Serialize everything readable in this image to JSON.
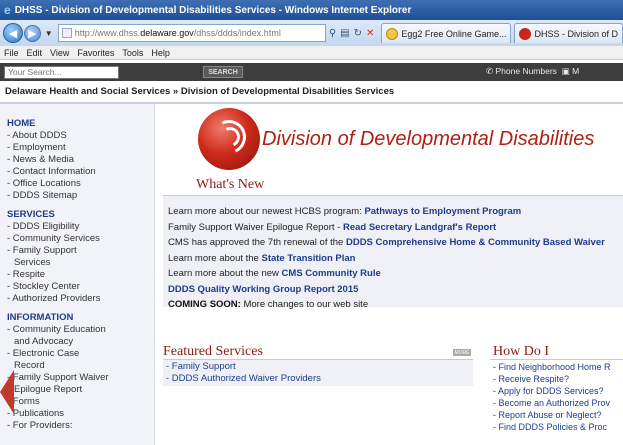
{
  "window": {
    "title": "DHSS - Division of Developmental Disabilities Services - Windows Internet Explorer"
  },
  "address_bar": {
    "url_prefix": "http://www.dhss.",
    "url_domain": "delaware.gov",
    "url_path": "/dhss/ddds/index.html"
  },
  "tabs": [
    {
      "label": "Egg2 Free Online Game..."
    },
    {
      "label": "DHSS - Division of D"
    }
  ],
  "menu": [
    "File",
    "Edit",
    "View",
    "Favorites",
    "Tools",
    "Help"
  ],
  "site_bar": {
    "search_placeholder": "Your Search...",
    "search_button": "SEARCH",
    "right_text": "Phone Numbers",
    "right_text_2": "M"
  },
  "breadcrumb": "Delaware Health and Social Services » Division of Developmental Disabilities Services",
  "leftnav": {
    "home": {
      "heading": "HOME",
      "items": [
        "- About DDDS",
        "- Employment",
        "- News & Media",
        "- Contact Information",
        "- Office Locations",
        "- DDDS Sitemap"
      ]
    },
    "services": {
      "heading": "SERVICES",
      "items": [
        "- DDDS Eligibility",
        "- Community Services",
        "- Family Support",
        "Services",
        "- Respite",
        "- Stockley Center",
        "- Authorized Providers"
      ]
    },
    "information": {
      "heading": "INFORMATION",
      "items": [
        "- Community Education",
        "and Advocacy",
        "- Electronic Case",
        "Record",
        "- Family Support Waiver",
        "Epilogue Report",
        "- Forms",
        "- Publications",
        "- For Providers:"
      ]
    }
  },
  "main": {
    "division_title": "Division of Developmental Disabilities",
    "whats_new_title": "What's New",
    "whats_new": [
      {
        "text": "Learn more about our newest HCBS program: ",
        "link": "Pathways to Employment Program"
      },
      {
        "text": "Family Support Waiver Epilogue Report - ",
        "link": "Read Secretary Landgraf's Report"
      },
      {
        "text": "CMS has approved the 7th renewal of the ",
        "link": "DDDS Comprehensive Home & Community Based Waiver"
      },
      {
        "text": "Learn more about the ",
        "link": "State Transition Plan"
      },
      {
        "text": "Learn more about the new ",
        "link": "CMS Community Rule"
      },
      {
        "text": "",
        "link": "DDDS Quality Working Group Report 2015"
      },
      {
        "bold": "COMING SOON:",
        "text": "  More changes to our web site"
      }
    ],
    "featured_title": "Featured Services",
    "more_label": "MORE",
    "featured": [
      "- Family Support",
      "- DDDS Authorized Waiver Providers"
    ],
    "howdo_title": "How Do I",
    "howdo": [
      "- Find Neighborhood Home R",
      "- Receive Respite?",
      "- Apply for DDDS Services?",
      "- Become an Authorized Prov",
      "- Report Abuse or Neglect?",
      "- Find DDDS Policies & Proc"
    ]
  },
  "colors": {
    "nav_link": "#1d3c8c",
    "heading_red": "#8c1a12",
    "title_red": "#b11e12",
    "arrow": "#bf3a2b"
  },
  "icons": [
    "ie-logo-icon",
    "back-arrow-icon",
    "forward-arrow-icon",
    "refresh-icon",
    "stop-icon",
    "search-icon",
    "rss-icon"
  ]
}
